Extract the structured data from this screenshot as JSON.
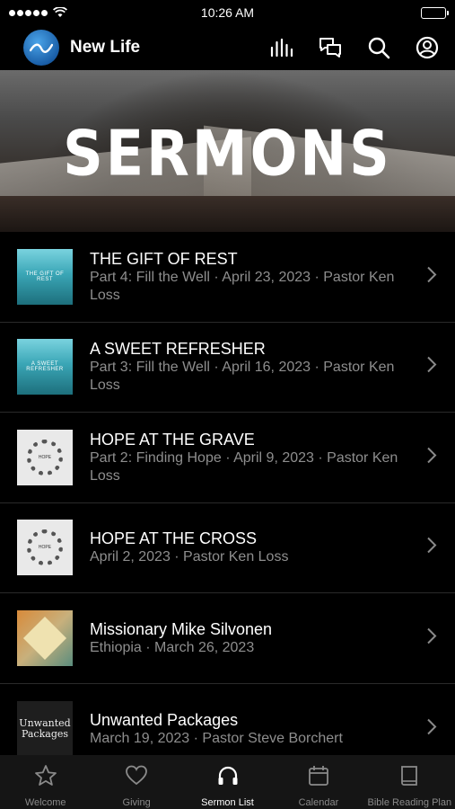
{
  "status": {
    "time": "10:26 AM"
  },
  "header": {
    "app_title": "New Life",
    "icons": [
      "audio-bars-icon",
      "chat-bubbles-icon",
      "search-icon",
      "profile-icon"
    ]
  },
  "hero": {
    "title": "SERMONS"
  },
  "sermons": [
    {
      "title": "THE GIFT OF REST",
      "subtitle": "Part 4: Fill the Well · April 23, 2023 · Pastor Ken Loss",
      "thumb_text": "THE GIFT OF REST"
    },
    {
      "title": "A SWEET REFRESHER",
      "subtitle": "Part 3: Fill the Well · April 16, 2023 · Pastor Ken Loss",
      "thumb_text": "A SWEET REFRESHER"
    },
    {
      "title": "HOPE AT THE GRAVE",
      "subtitle": "Part 2: Finding Hope · April 9, 2023 · Pastor Ken Loss",
      "thumb_text": "HOPE"
    },
    {
      "title": "HOPE AT THE CROSS",
      "subtitle": "April 2, 2023 · Pastor Ken Loss",
      "thumb_text": "HOPE"
    },
    {
      "title": "Missionary Mike Silvonen",
      "subtitle": "Ethiopia · March 26, 2023"
    },
    {
      "title": "Unwanted Packages",
      "subtitle": "March 19, 2023 · Pastor Steve Borchert",
      "thumb_text": "Unwanted Packages"
    }
  ],
  "tabs": [
    {
      "label": "Welcome",
      "icon": "star-icon"
    },
    {
      "label": "Giving",
      "icon": "heart-icon"
    },
    {
      "label": "Sermon List",
      "icon": "headphones-icon",
      "active": true
    },
    {
      "label": "Calendar",
      "icon": "calendar-icon"
    },
    {
      "label": "Bible Reading Plan",
      "icon": "book-icon"
    }
  ]
}
